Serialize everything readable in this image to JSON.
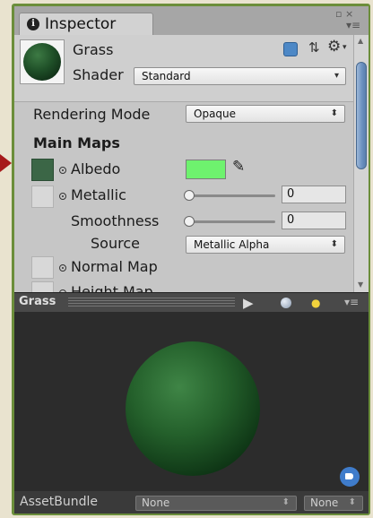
{
  "window": {
    "tab_label": "Inspector",
    "tab_icon": "info-icon",
    "controls": {
      "maximize_icon": "maximize-icon",
      "menu_icon": "window-menu-icon"
    }
  },
  "material": {
    "name": "Grass",
    "shader_label": "Shader",
    "shader_value": "Standard",
    "header_icons": [
      "material-book-icon",
      "presets-icon",
      "gear-icon"
    ]
  },
  "properties": {
    "rendering_mode_label": "Rendering Mode",
    "rendering_mode_value": "Opaque",
    "main_maps_heading": "Main Maps",
    "albedo_label": "Albedo",
    "albedo_color": "#6ef26e",
    "metallic_label": "Metallic",
    "metallic_value": "0",
    "smoothness_label": "Smoothness",
    "smoothness_value": "0",
    "source_label": "Source",
    "source_value": "Metallic Alpha",
    "normal_map_label": "Normal Map",
    "height_map_label": "Height Map"
  },
  "preview": {
    "title": "Grass",
    "icons": [
      "play-icon",
      "sphere-icon",
      "lights-icon",
      "preview-menu-icon"
    ]
  },
  "asset_bundle": {
    "label": "AssetBundle",
    "name_value": "None",
    "variant_value": "None"
  },
  "colors": {
    "accent_scroll": "#6a8fbf",
    "pointer_arrow": "#a61a1a",
    "sphere_green": "#24602b"
  }
}
